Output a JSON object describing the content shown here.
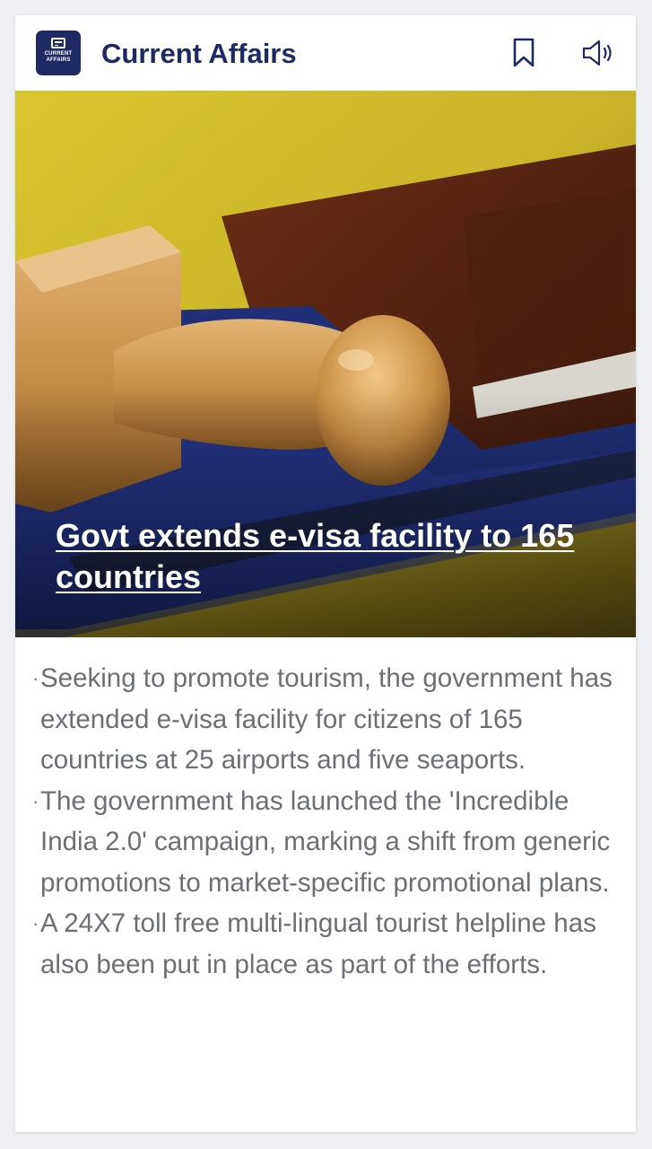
{
  "header": {
    "logo_line1": "CURRENT",
    "logo_line2": "AFFAIRS",
    "title": "Current Affairs",
    "bookmark_icon": "bookmark-icon",
    "speaker_icon": "speaker-icon"
  },
  "article": {
    "headline": "Govt extends e-visa facility to 165 countries",
    "bullets": [
      "Seeking to promote tourism, the government has extended e-visa facility for citizens of 165 countries at 25 airports and five seaports.",
      "The government has launched the 'Incredible India 2.0' campaign, marking a shift from generic promotions to market-specific promotional plans.",
      "A 24X7 toll free multi-lingual tourist helpline has also been put in place as part of the efforts."
    ],
    "bullet_marker": "·"
  },
  "colors": {
    "brand": "#1f2a63",
    "body_text": "#6b6f76",
    "background": "#eef0f3"
  }
}
